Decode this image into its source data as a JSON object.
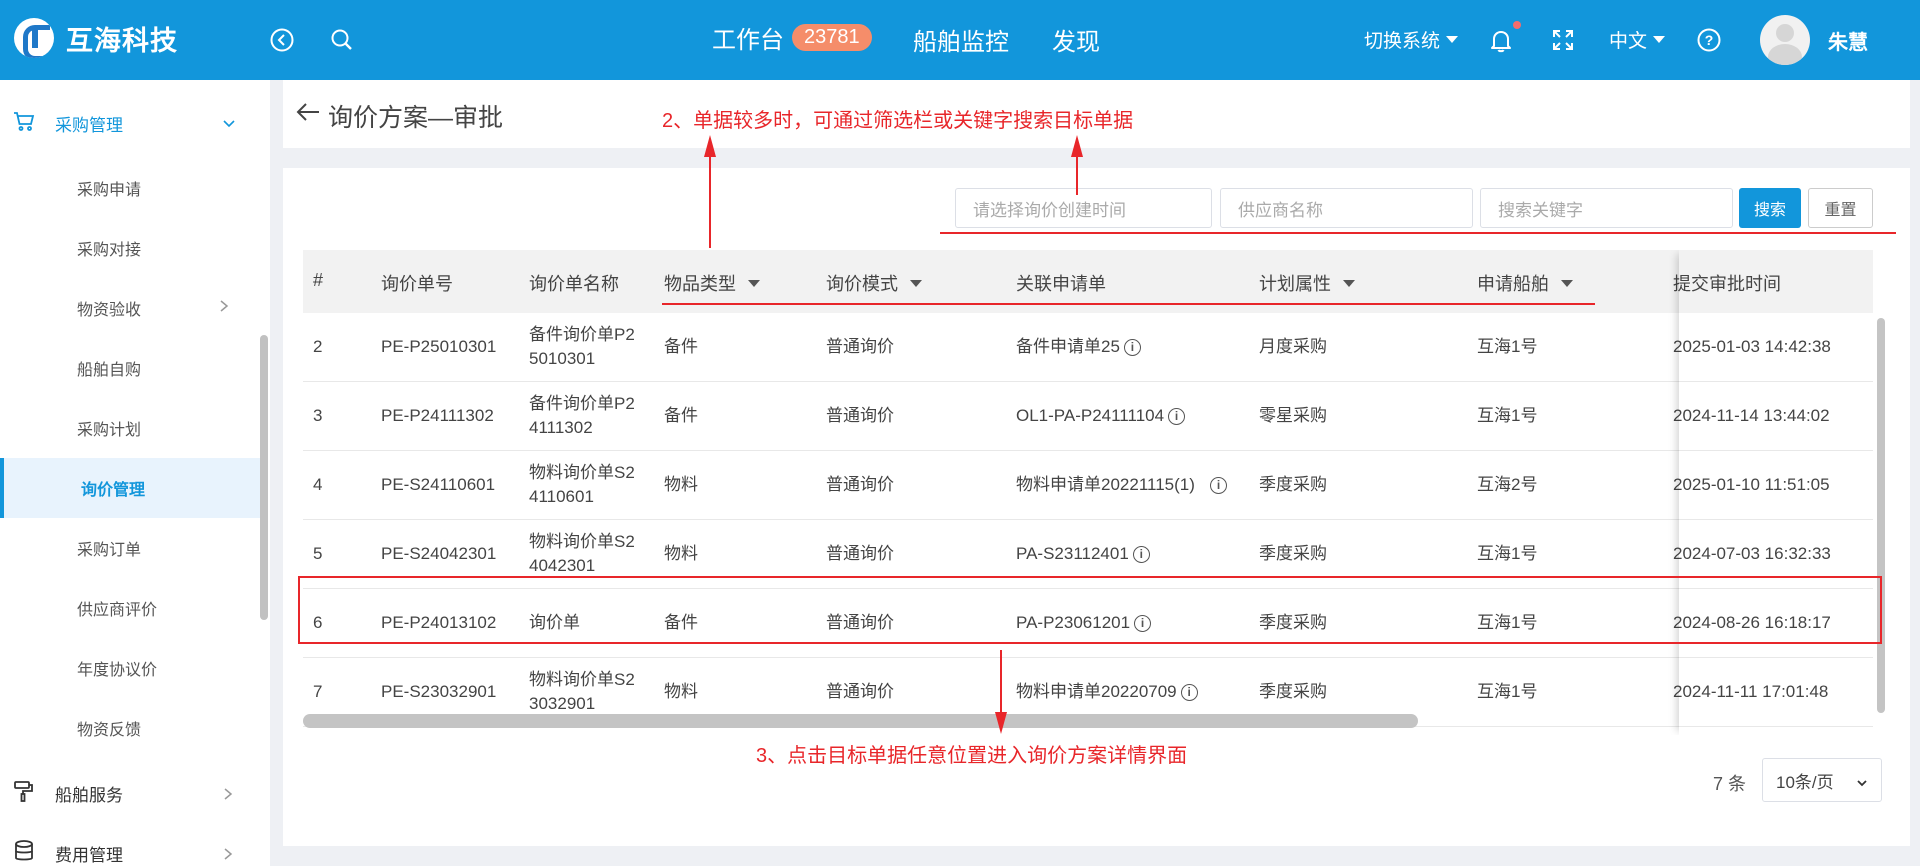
{
  "brand": {
    "name": "互海科技"
  },
  "header": {
    "workbench_label": "工作台",
    "workbench_count": "23781",
    "nav_ship_monitor": "船舶监控",
    "nav_discover": "发现",
    "switch_system": "切换系统",
    "language": "中文",
    "user_name": "朱慧"
  },
  "sidebar": {
    "purchase_group": "采购管理",
    "items": [
      "采购申请",
      "采购对接",
      "物资验收",
      "船舶自购",
      "采购计划",
      "询价管理",
      "采购订单",
      "供应商评价",
      "年度协议价",
      "物资反馈"
    ],
    "ship_service": "船舶服务",
    "cost_management": "费用管理"
  },
  "page": {
    "title": "询价方案—审批"
  },
  "filters": {
    "create_time_placeholder": "请选择询价创建时间",
    "supplier_placeholder": "供应商名称",
    "keyword_placeholder": "搜索关键字",
    "search_label": "搜索",
    "reset_label": "重置"
  },
  "table": {
    "headers": {
      "index": "#",
      "inquiry_no": "询价单号",
      "inquiry_name": "询价单名称",
      "item_type": "物品类型",
      "inquiry_mode": "询价模式",
      "related_request": "关联申请单",
      "plan_attr": "计划属性",
      "request_ship": "申请船舶",
      "submit_time": "提交审批时间"
    },
    "rows": [
      {
        "index": "2",
        "no": "PE-P25010301",
        "name": "备件询价单P25010301",
        "type": "备件",
        "mode": "普通询价",
        "request": "备件申请单25",
        "plan": "月度采购",
        "ship": "互海1号",
        "time": "2025-01-03 14:42:38"
      },
      {
        "index": "3",
        "no": "PE-P24111302",
        "name": "备件询价单P24111302",
        "type": "备件",
        "mode": "普通询价",
        "request": "OL1-PA-P24111104",
        "plan": "零星采购",
        "ship": "互海1号",
        "time": "2024-11-14 13:44:02"
      },
      {
        "index": "4",
        "no": "PE-S24110601",
        "name": "物料询价单S24110601",
        "type": "物料",
        "mode": "普通询价",
        "request": "物料申请单20221115(1)",
        "plan": "季度采购",
        "ship": "互海2号",
        "time": "2025-01-10 11:51:05"
      },
      {
        "index": "5",
        "no": "PE-S24042301",
        "name": "物料询价单S24042301",
        "type": "物料",
        "mode": "普通询价",
        "request": "PA-S23112401",
        "plan": "季度采购",
        "ship": "互海1号",
        "time": "2024-07-03 16:32:33"
      },
      {
        "index": "6",
        "no": "PE-P24013102",
        "name": "询价单",
        "type": "备件",
        "mode": "普通询价",
        "request": "PA-P23061201",
        "plan": "季度采购",
        "ship": "互海1号",
        "time": "2024-08-26 16:18:17"
      },
      {
        "index": "7",
        "no": "PE-S23032901",
        "name": "物料询价单S23032901",
        "type": "物料",
        "mode": "普通询价",
        "request": "物料申请单20220709",
        "plan": "季度采购",
        "ship": "互海1号",
        "time": "2024-11-11 17:01:48"
      }
    ]
  },
  "pagination": {
    "total": "7 条",
    "page_size": "10条/页"
  },
  "annotations": {
    "step2": "2、单据较多时，可通过筛选栏或关键字搜索目标单据",
    "step3": "3、点击目标单据任意位置进入询价方案详情界面"
  },
  "colors": {
    "primary": "#1296db",
    "annotation": "#e8262a",
    "badge": "#f58d6a"
  }
}
